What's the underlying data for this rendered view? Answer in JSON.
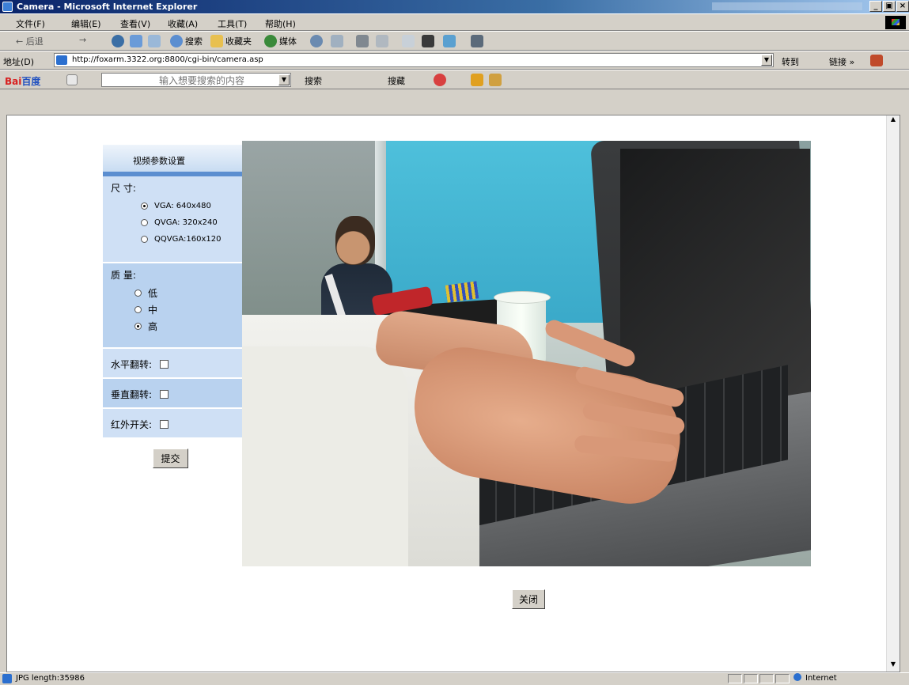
{
  "window": {
    "title": "Camera - Microsoft Internet Explorer",
    "minimize": "_",
    "maximize": "▣",
    "close": "×"
  },
  "menu": [
    "文件(F)",
    "编辑(E)",
    "查看(V)",
    "收藏(A)",
    "工具(T)",
    "帮助(H)"
  ],
  "toolbar": {
    "back": "← 后退",
    "forward": "→",
    "search": "搜索",
    "favorites": "收藏夹",
    "media": "媒体"
  },
  "address": {
    "label": "地址(D)",
    "url": "http://foxarm.3322.org:8800/cgi-bin/camera.asp",
    "go": "转到",
    "links": "链接 »"
  },
  "baidu": {
    "logo_bai": "Bai",
    "logo_du": "百度",
    "placeholder": "输入想要搜索的内容",
    "search": "搜索",
    "collect": "搜藏"
  },
  "panel": {
    "title": "视频参数设置",
    "size_label": "尺 寸:",
    "sizes": [
      "VGA:  640x480",
      "QVGA: 320x240",
      "QQVGA:160x120"
    ],
    "quality_label": "质 量:",
    "qualities": [
      "低",
      "中",
      "高"
    ],
    "hflip_label": "水平翻转:",
    "vflip_label": "垂直翻转:",
    "ir_label": "红外开关:",
    "submit": "提交"
  },
  "close_button": "关闭",
  "status": {
    "text": "JPG length:35986",
    "zone": "Internet"
  }
}
